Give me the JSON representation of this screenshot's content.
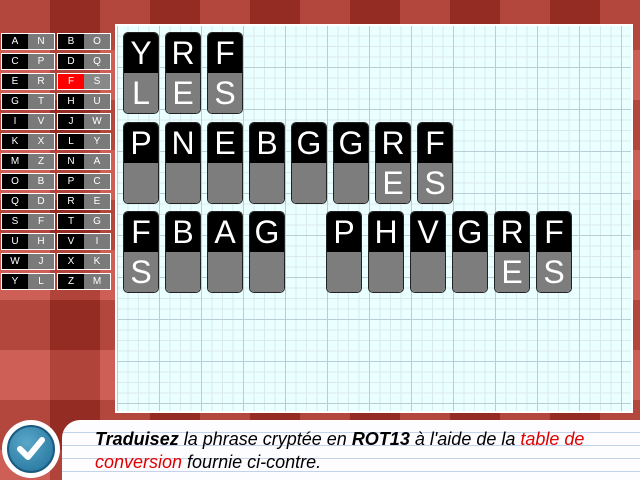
{
  "conversion_table": [
    [
      [
        "A",
        "N"
      ],
      [
        "B",
        "O"
      ]
    ],
    [
      [
        "C",
        "P"
      ],
      [
        "D",
        "Q"
      ]
    ],
    [
      [
        "E",
        "R"
      ],
      [
        "F",
        "S"
      ]
    ],
    [
      [
        "G",
        "T"
      ],
      [
        "H",
        "U"
      ]
    ],
    [
      [
        "I",
        "V"
      ],
      [
        "J",
        "W"
      ]
    ],
    [
      [
        "K",
        "X"
      ],
      [
        "L",
        "Y"
      ]
    ],
    [
      [
        "M",
        "Z"
      ],
      [
        "N",
        "A"
      ]
    ],
    [
      [
        "O",
        "B"
      ],
      [
        "P",
        "C"
      ]
    ],
    [
      [
        "Q",
        "D"
      ],
      [
        "R",
        "E"
      ]
    ],
    [
      [
        "S",
        "F"
      ],
      [
        "T",
        "G"
      ]
    ],
    [
      [
        "U",
        "H"
      ],
      [
        "V",
        "I"
      ]
    ],
    [
      [
        "W",
        "J"
      ],
      [
        "X",
        "K"
      ]
    ],
    [
      [
        "Y",
        "L"
      ],
      [
        "Z",
        "M"
      ]
    ]
  ],
  "selected_pair": "F-S",
  "words": [
    {
      "cipher": [
        "Y",
        "R",
        "F"
      ],
      "plain": [
        "L",
        "E",
        "S"
      ]
    },
    {
      "cipher": [
        "P",
        "N",
        "E",
        "B",
        "G",
        "G",
        "R",
        "F"
      ],
      "plain": [
        "",
        "",
        "",
        "",
        "",
        "",
        "E",
        "S"
      ]
    },
    {
      "cipher": [
        "F",
        "B",
        "A",
        "G"
      ],
      "plain": [
        "S",
        "",
        "",
        ""
      ]
    },
    {
      "cipher": [
        "P",
        "H",
        "V",
        "G",
        "R",
        "F"
      ],
      "plain": [
        "",
        "",
        "",
        "",
        "E",
        "S"
      ]
    }
  ],
  "instruction": {
    "verb": "Traduisez",
    "part1": " la phrase cryptée en ",
    "cipher_name": "ROT13",
    "part2": " à l'aide de la ",
    "link": "table de conversion",
    "part3": " fournie ci-contre."
  },
  "icons": {
    "validate": "check-icon"
  },
  "colors": {
    "selected": "#ff0000",
    "link": "#e00000",
    "tile_top": "#000000",
    "tile_bottom": "#7d7d7d"
  }
}
